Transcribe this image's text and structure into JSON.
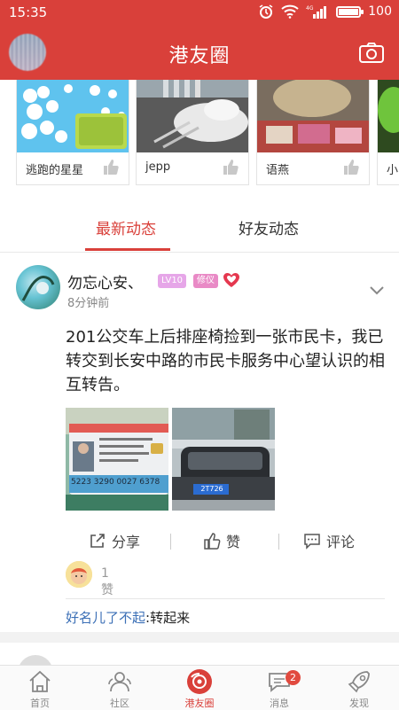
{
  "status_bar": {
    "time": "15:35",
    "battery": "100"
  },
  "header": {
    "title": "港友圈"
  },
  "featured": [
    {
      "name": "逃跑的星星"
    },
    {
      "name": "jepp"
    },
    {
      "name": "语燕"
    },
    {
      "name": "小"
    }
  ],
  "tabs": [
    {
      "label": "最新动态",
      "active": true
    },
    {
      "label": "好友动态",
      "active": false
    }
  ],
  "post": {
    "username": "勿忘心安、",
    "level_badge": "LV10",
    "role_badge": "修仪",
    "time": "8分钟前",
    "text": "201公交车上后排座椅捡到一张市民卡，我已转交到长安中路的市民卡服务中心望认识的相互转告。",
    "card_number": "5223 3290 0027 6378",
    "plate_text": "2T726",
    "actions": {
      "share": "分享",
      "like": "赞",
      "comment": "评论"
    },
    "like_count": "1赞",
    "comment": {
      "author": "好名儿了不起",
      "text": ":转起来"
    }
  },
  "nav": {
    "items": [
      {
        "label": "首页",
        "active": false
      },
      {
        "label": "社区",
        "active": false
      },
      {
        "label": "港友圈",
        "active": true
      },
      {
        "label": "消息",
        "active": false,
        "badge": "2"
      },
      {
        "label": "发现",
        "active": false
      }
    ]
  },
  "colors": {
    "accent": "#d9403a",
    "link": "#3b6fb6"
  }
}
